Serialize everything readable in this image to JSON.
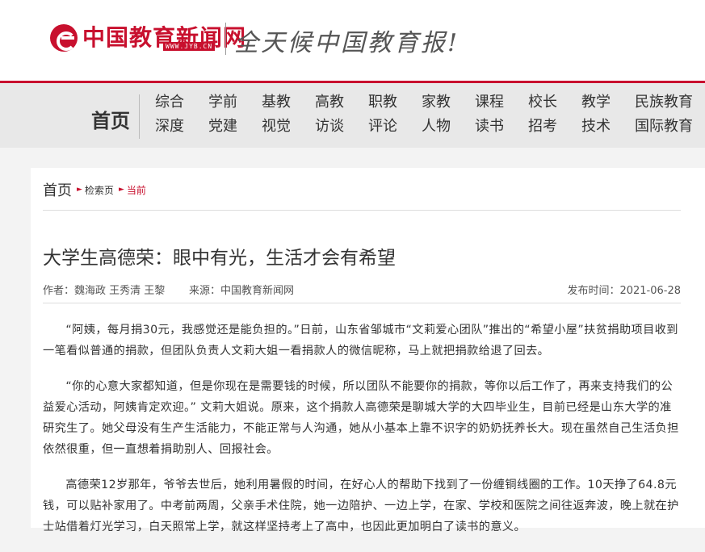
{
  "header": {
    "logo_text": "中国教育新闻网",
    "logo_url": "WWW.JYB.CN",
    "slogan": "全天候中国教育报!"
  },
  "nav": {
    "home": "首页",
    "row1": [
      "综合",
      "学前",
      "基教",
      "高教",
      "职教",
      "家教",
      "课程",
      "校长",
      "教学",
      "民族教育"
    ],
    "row2": [
      "深度",
      "党建",
      "视觉",
      "访谈",
      "评论",
      "人物",
      "读书",
      "招考",
      "技术",
      "国际教育"
    ]
  },
  "breadcrumb": {
    "home": "首页",
    "middle": "检索页",
    "current": "当前"
  },
  "article": {
    "title": "大学生高德荣：眼中有光，生活才会有希望",
    "author": "作者：魏海政 王秀清 王黎",
    "source": "来源：中国教育新闻网",
    "date": "发布时间：2021-06-28",
    "paragraphs": [
      "“阿姨，每月捐30元，我感觉还是能负担的。”日前，山东省邹城市“文莉爱心团队”推出的“希望小屋”扶贫捐助项目收到一笔看似普通的捐款，但团队负责人文莉大姐一看捐款人的微信昵称，马上就把捐款给退了回去。",
      "“你的心意大家都知道，但是你现在是需要钱的时候，所以团队不能要你的捐款，等你以后工作了，再来支持我们的公益爱心活动，阿姨肯定欢迎。” 文莉大姐说。原来，这个捐款人高德荣是聊城大学的大四毕业生，目前已经是山东大学的准研究生了。她父母没有生产生活能力，不能正常与人沟通，她从小基本上靠不识字的奶奶抚养长大。现在虽然自己生活负担依然很重，但一直想着捐助别人、回报社会。",
      "高德荣12岁那年，爷爷去世后，她利用暑假的时间，在好心人的帮助下找到了一份缠铜线圈的工作。10天挣了64.8元钱，可以贴补家用了。中考前两周，父亲手术住院，她一边陪护、一边上学，在家、学校和医院之间往返奔波，晚上就在护士站借着灯光学习，白天照常上学，就这样坚持考上了高中，也因此更加明白了读书的意义。"
    ]
  }
}
